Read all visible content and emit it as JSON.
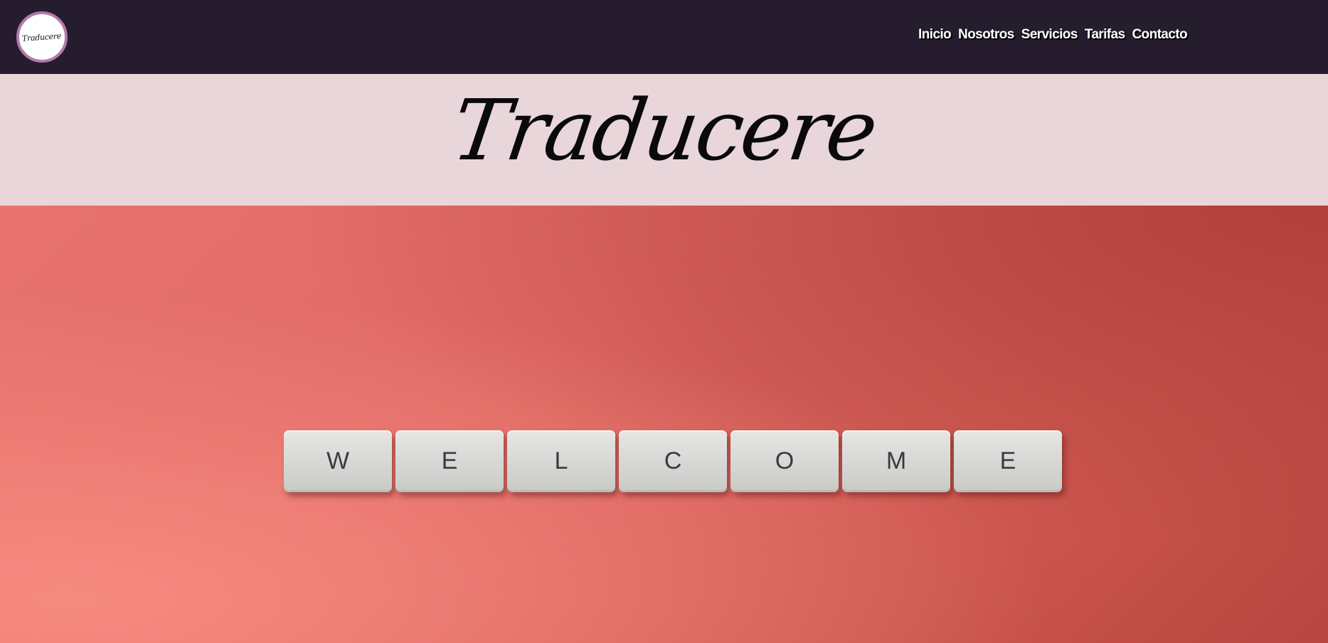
{
  "navbar": {
    "logo_text": "Traducere",
    "links": [
      {
        "label": "Inicio"
      },
      {
        "label": "Nosotros"
      },
      {
        "label": "Servicios"
      },
      {
        "label": "Tarifas"
      },
      {
        "label": "Contacto"
      }
    ]
  },
  "banner": {
    "title": "Traducere"
  },
  "hero": {
    "tiles": [
      "W",
      "E",
      "L",
      "C",
      "O",
      "M",
      "E"
    ]
  },
  "colors": {
    "navbar_bg": "#251c2e",
    "banner_bg": "#e9d6da",
    "hero_bg": "#df6863",
    "logo_ring": "#b27aa9"
  }
}
